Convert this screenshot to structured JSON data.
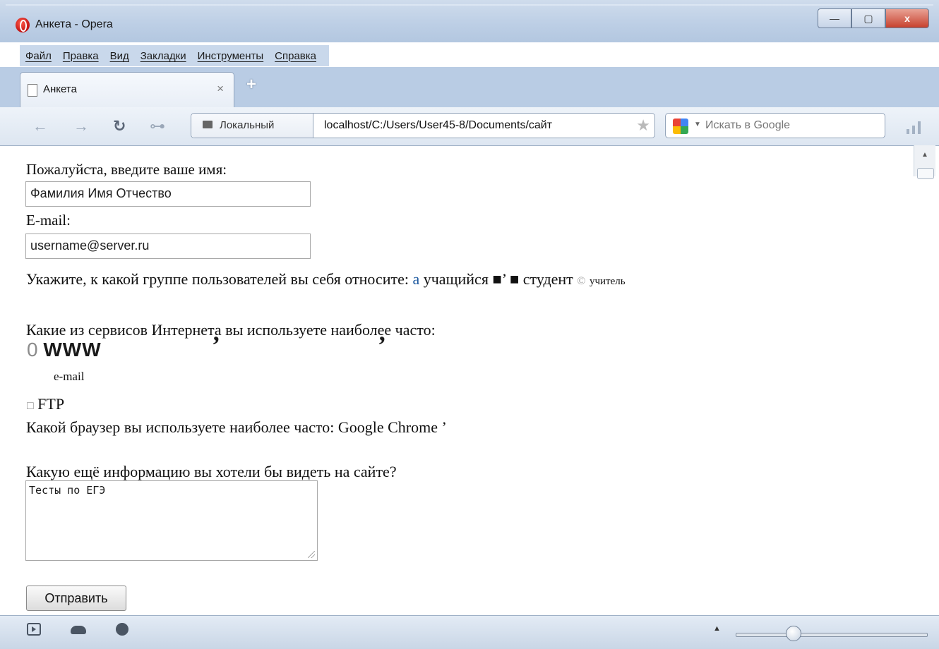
{
  "window": {
    "title": "Анкета - Opera",
    "buttons": {
      "minimize": "—",
      "maximize": "▢",
      "close": "x"
    }
  },
  "menu": [
    "Файл",
    "Правка",
    "Вид",
    "Закладки",
    "Инструменты",
    "Справка"
  ],
  "tab": {
    "label": "Анкета",
    "close": "×",
    "new_tab": "+"
  },
  "toolbar": {
    "back": "←",
    "forward": "→",
    "reload": "↻",
    "key": "⊶",
    "security_badge": "Локальный",
    "url": "localhost/C:/Users/User45-8/Documents/сайт",
    "star": "★",
    "search_placeholder": "Искать в Google"
  },
  "form": {
    "name_label": "Пожалуйста, введите ваше имя:",
    "name_value": "Фамилия Имя Отчество",
    "email_label": "E-mail:",
    "email_value": "username@server.ru",
    "group_question": "Укажите, к какой группе пользователей вы себя относите:",
    "group_a": "а",
    "group_pupil": "учащийся",
    "group_mark1": "■",
    "group_quote": "’",
    "group_mark2": "■",
    "group_student": "студент",
    "group_copy": "©",
    "group_teacher": "учитель",
    "services_question": "Какие из сервисов Интернета вы используете наиболее часто:",
    "www_mark": "0",
    "www_label": "WWW",
    "tick1": "’",
    "tick2": "’",
    "email_service": "e-mail",
    "ftp_box": "□",
    "ftp_label": "FTP",
    "browser_question": "Какой браузер вы используете наиболее часто:",
    "browser_value": "Google Chrome",
    "browser_quote": "’",
    "info_question": "Какую ещё информацию вы хотели бы видеть на сайте?",
    "info_value": "Тесты по ЕГЭ",
    "submit": "Отправить"
  },
  "statusbar": {
    "up_arrow": "▲",
    "zoom_level": 0.3
  }
}
